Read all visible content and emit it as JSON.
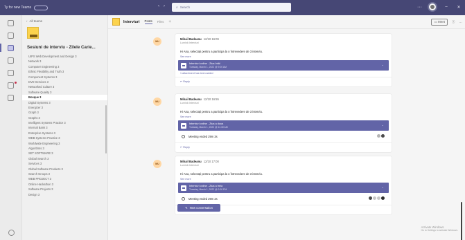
{
  "titlebar": {
    "app_label": "Ty for new Teams",
    "search_placeholder": "Search",
    "nav_back": "‹",
    "nav_forward": "›",
    "more": "···",
    "minimize": "–",
    "close": "✕"
  },
  "rail": {
    "items": [
      "activity",
      "chat",
      "teams",
      "calendar",
      "calls",
      "files",
      "apps"
    ]
  },
  "panel": {
    "back_label": "All teams",
    "team_name": "Sesiuni de interviu - Zilele Carie...",
    "channels": [
      "UIPS Web Development and Design 3",
      "Network 3",
      "Computer Engineering 3",
      "Ethnic Flexibility and Truth 3",
      "Component Systems 3",
      "DVD Services 3",
      "Networked Culture 3",
      "Software Quality 3",
      "Bosque 3",
      "Digital Systems 3",
      "Energizer 3",
      "Graph 3",
      "Graphs 3",
      "Intelligent Systems Practice 3",
      "Internal Bank 3",
      "Enterprise Systems 3",
      "WEB Systems Practice 3",
      "Worldwide Engineering 3",
      "Algorithms 3",
      "SET SOFTWARE 3",
      "Global Search 3",
      "Services 3",
      "Global Software Products 3",
      "Search Groups 3",
      "WEB PROJECT 3",
      "Online Hackathon 3",
      "Software Projects 3",
      "Design 3"
    ],
    "selected_index": 8
  },
  "header": {
    "title": "Interviuri",
    "tabs": [
      "Posts",
      "Files"
    ],
    "active_tab": 0,
    "plus": "+",
    "meet_label": "Meet",
    "info": "ⓘ",
    "more": "···"
  },
  "posts": [
    {
      "avatar": "MU",
      "author": "Mihail Badeanu",
      "time": "12/10 16:09",
      "subtitle": "Lumină Interviuri",
      "body": "Hi Ana, selectați pentru a participa la o întrevedere de 3 interviu.",
      "see_more": "See more",
      "meeting_title": "Interviuri online - Ziua întâi",
      "meeting_time": "Tuesday, March 1, 2022 @ 9:00 AM",
      "recording": null,
      "attachment": "1 attachment has been added",
      "reply": "Reply"
    },
    {
      "avatar": "MU",
      "author": "Mihail Badeanu",
      "time": "12/10 16:55",
      "subtitle": "Lumină Interviuri",
      "body": "Hi Ana, selectați pentru a participa la o întrevedere de 3 interviu.",
      "see_more": "See more",
      "meeting_title": "Interviuri online - Ziua a doua",
      "meeting_time": "Tuesday, March 1, 2022 @ 11:30 AM",
      "recording": "Meeting ended 29m 3s",
      "attachment": null,
      "reply": "Reply"
    },
    {
      "avatar": "MU",
      "author": "Mihail Badeanu",
      "time": "12/10 17:00",
      "subtitle": "Lumină Interviuri",
      "body": "Hi Ana, selectați pentru a participa la o întrevedere de 3 interviu.",
      "see_more": "See more",
      "meeting_title": "Interviuri online - Ziua a treia",
      "meeting_time": "Tuesday, March 1, 2022 @ 2:00 PM",
      "recording": "Meeting ended 29m 2s",
      "attachment": null,
      "reply": "Reply"
    }
  ],
  "new_conversation": "New conversation",
  "activate": {
    "title": "Activate Windows",
    "sub": "Go to Settings to activate Windows."
  },
  "colors": {
    "brand": "#6264a7",
    "titlebar": "#464775",
    "logo": "#fcd34d"
  }
}
